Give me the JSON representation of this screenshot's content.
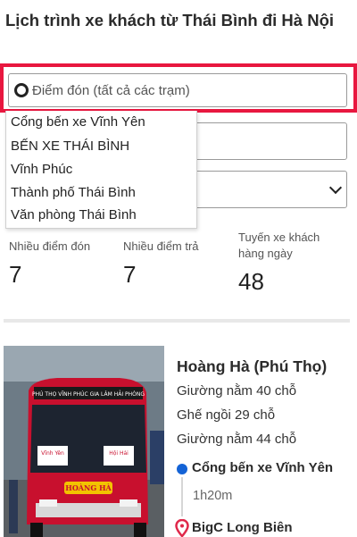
{
  "page": {
    "title": "Lịch trình xe khách từ Thái Bình đi Hà Nội"
  },
  "search": {
    "pickup_placeholder": "Điểm đón (tất cả các trạm)",
    "dropdown_options": [
      "Cổng bến xe Vĩnh Yên",
      "BẾN XE THÁI BÌNH",
      "Vĩnh Phúc",
      "Thành phố Thái Bình",
      "Văn phòng Thái Bình"
    ]
  },
  "stats": [
    {
      "label": "Nhiều điểm đón",
      "value": "7"
    },
    {
      "label": "Nhiều điểm trả",
      "value": "7"
    },
    {
      "label": "Tuyến xe khách hàng ngày",
      "value": "48"
    }
  ],
  "bus": {
    "operator": "Hoàng Hà (Phú Thọ)",
    "seat_types": [
      "Giường nằm 40 chỗ",
      "Ghế ngồi 29 chỗ",
      "Giường nằm 44 chỗ"
    ],
    "from": "Cổng bến xe Vĩnh Yên",
    "duration": "1h20m",
    "to": "BigC Long Biên",
    "image_text": {
      "destinations": "PHÚ THỌ VĨNH PHÚC GIA LÂM HẢI PHÒNG",
      "brand": "HOÀNG HÀ",
      "window_left": "Vĩnh Yên",
      "window_right": "Hội Hải"
    }
  },
  "colors": {
    "highlight": "#e8173f",
    "route_dot": "#1463d6",
    "pin": "#e0284a",
    "bus_body": "#c8102e"
  }
}
